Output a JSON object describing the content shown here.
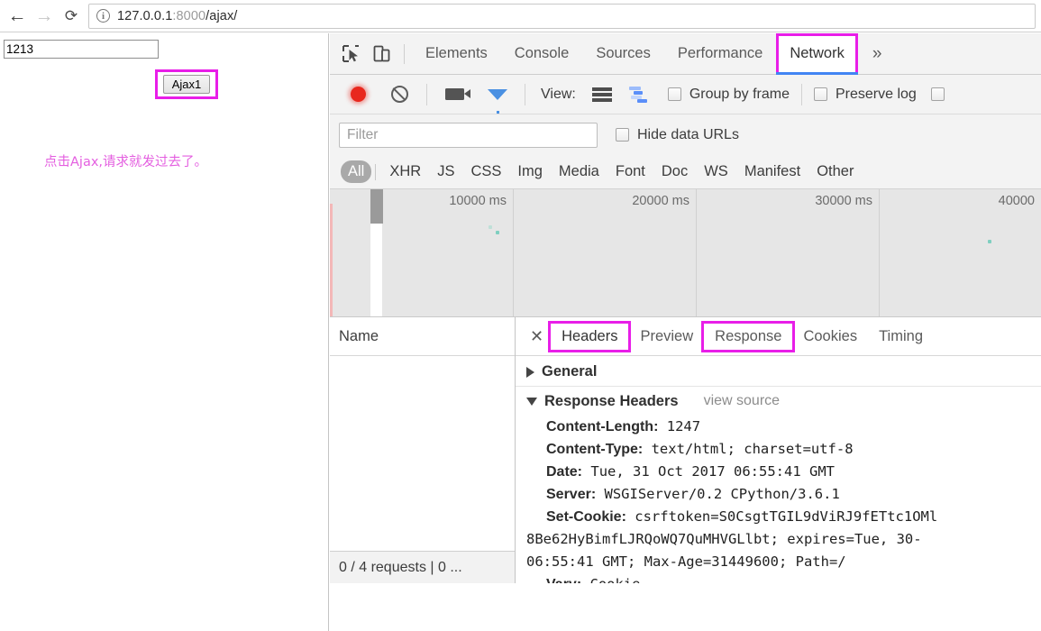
{
  "browser": {
    "back_icon": "arrow-left-icon",
    "forward_icon": "arrow-right-icon",
    "reload_icon": "reload-icon",
    "info_icon": "info-icon",
    "url_host": "127.0.0.1",
    "url_port": ":8000",
    "url_path": "/ajax/"
  },
  "page": {
    "input_value": "1213",
    "button_label": "Ajax1",
    "message": "点击Ajax,请求就发过去了。",
    "message_color": "#e45fe0",
    "highlight_color": "#e81ee8"
  },
  "devtools": {
    "inspect_icon": "inspect-element-icon",
    "device_icon": "device-toolbar-icon",
    "tabs": [
      {
        "label": "Elements",
        "active": false,
        "boxed": false
      },
      {
        "label": "Console",
        "active": false,
        "boxed": false
      },
      {
        "label": "Sources",
        "active": false,
        "boxed": false
      },
      {
        "label": "Performance",
        "active": false,
        "boxed": false
      },
      {
        "label": "Network",
        "active": true,
        "boxed": true
      }
    ],
    "overflow_label": "»",
    "toolbar": {
      "record_icon": "record-circle-icon",
      "clear_icon": "clear-icon",
      "camera_icon": "camera-icon",
      "funnel_icon": "filter-funnel-icon",
      "view_label": "View:",
      "list_view_icon": "list-view-icon",
      "waterfall_view_icon": "waterfall-view-icon",
      "group_by_frame_label": "Group by frame",
      "preserve_log_label": "Preserve log"
    },
    "filter": {
      "placeholder": "Filter",
      "value": "",
      "hide_data_urls_label": "Hide data URLs"
    },
    "types": [
      "All",
      "XHR",
      "JS",
      "CSS",
      "Img",
      "Media",
      "Font",
      "Doc",
      "WS",
      "Manifest",
      "Other"
    ],
    "types_selected": "All",
    "overview": {
      "ticks": [
        "10000 ms",
        "20000 ms",
        "30000 ms",
        "40000"
      ]
    },
    "name_column_header": "Name",
    "status_footer": "0 / 4 requests  |  0 ...",
    "detail_tabs": [
      {
        "label": "Headers",
        "active": true,
        "boxed": true
      },
      {
        "label": "Preview",
        "active": false,
        "boxed": false
      },
      {
        "label": "Response",
        "active": false,
        "boxed": true
      },
      {
        "label": "Cookies",
        "active": false,
        "boxed": false
      },
      {
        "label": "Timing",
        "active": false,
        "boxed": false
      }
    ],
    "close_icon": "close-icon",
    "sections": {
      "general_label": "General",
      "response_headers_label": "Response Headers",
      "view_source_label": "view source"
    },
    "headers": [
      {
        "key": "Content-Length:",
        "value": "1247"
      },
      {
        "key": "Content-Type:",
        "value": "text/html; charset=utf-8"
      },
      {
        "key": "Date:",
        "value": "Tue, 31 Oct 2017 06:55:41 GMT"
      },
      {
        "key": "Server:",
        "value": "WSGIServer/0.2 CPython/3.6.1"
      },
      {
        "key": "Set-Cookie:",
        "value": "csrftoken=S0CsgtTGIL9dViRJ9fETtc1OMl"
      }
    ],
    "header_continuations": [
      "8Be62HyBimfLJRQoWQ7QuMHVGLlbt; expires=Tue, 30-",
      "06:55:41 GMT; Max-Age=31449600; Path=/"
    ],
    "last_header": {
      "key": "Vary:",
      "value": "Cookie"
    }
  }
}
